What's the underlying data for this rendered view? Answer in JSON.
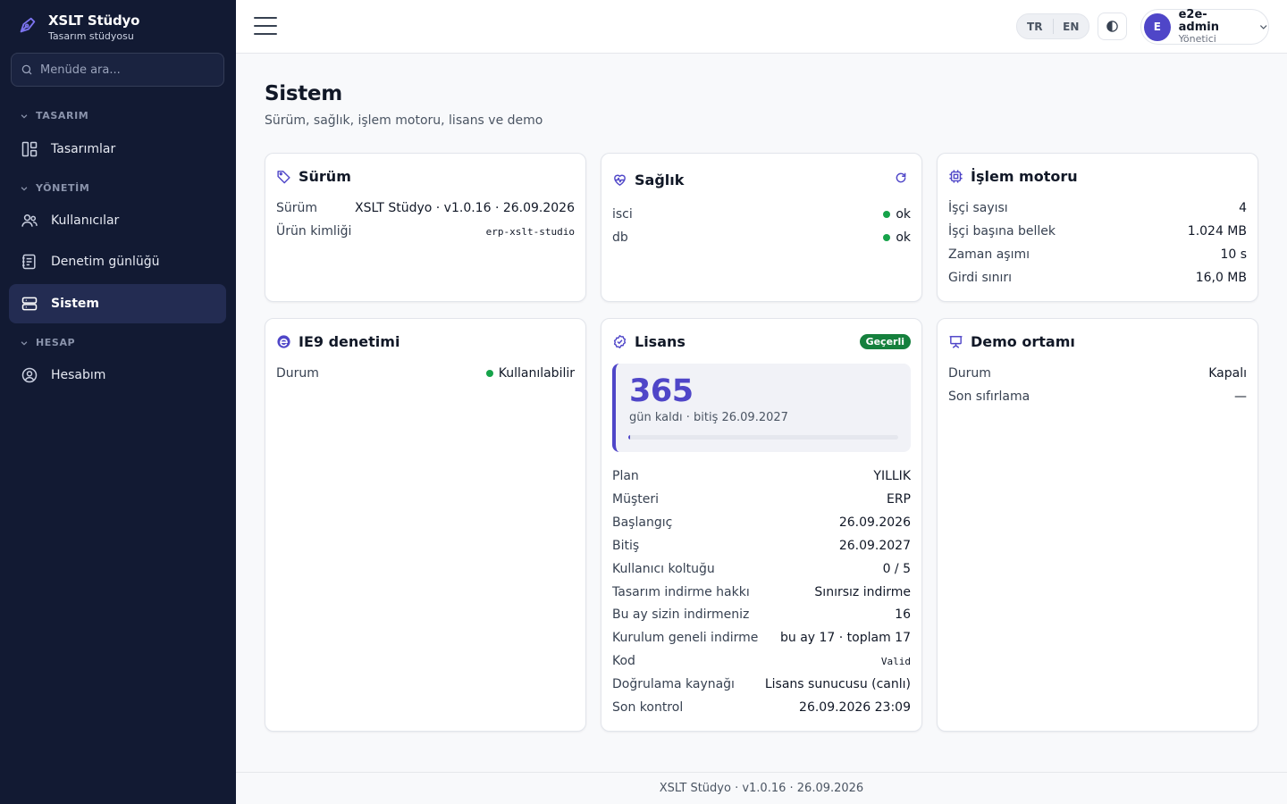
{
  "brand": {
    "title": "XSLT Stüdyo",
    "subtitle": "Tasarım stüdyosu"
  },
  "search": {
    "placeholder": "Menüde ara..."
  },
  "sidebar": {
    "sections": [
      {
        "label": "TASARIM"
      },
      {
        "label": "YÖNETİM"
      },
      {
        "label": "HESAP"
      }
    ],
    "items": [
      {
        "label": "Tasarımlar",
        "icon": "layout-icon"
      },
      {
        "label": "Kullanıcılar",
        "icon": "users-icon"
      },
      {
        "label": "Denetim günlüğü",
        "icon": "log-icon"
      },
      {
        "label": "Sistem",
        "icon": "server-icon",
        "active": true
      },
      {
        "label": "Hesabım",
        "icon": "user-circle-icon"
      }
    ]
  },
  "topbar": {
    "languages": [
      "TR",
      "EN"
    ],
    "user": {
      "initial": "E",
      "name": "e2e-admin",
      "role": "Yönetici"
    }
  },
  "page": {
    "title": "Sistem",
    "subtitle": "Sürüm, sağlık, işlem motoru, lisans ve demo"
  },
  "cards": {
    "version": {
      "title": "Sürüm",
      "rows": [
        {
          "k": "Sürüm",
          "v": "XSLT Stüdyo · v1.0.16 · 26.09.2026"
        },
        {
          "k": "Ürün kimliği",
          "v": "erp-xslt-studio"
        }
      ]
    },
    "health": {
      "title": "Sağlık",
      "rows": [
        {
          "k": "isci",
          "v": "ok"
        },
        {
          "k": "db",
          "v": "ok"
        }
      ]
    },
    "engine": {
      "title": "İşlem motoru",
      "rows": [
        {
          "k": "İşçi sayısı",
          "v": "4"
        },
        {
          "k": "İşçi başına bellek",
          "v": "1.024 MB"
        },
        {
          "k": "Zaman aşımı",
          "v": "10 s"
        },
        {
          "k": "Girdi sınırı",
          "v": "16,0 MB"
        }
      ]
    },
    "ie9": {
      "title": "IE9 denetimi",
      "rows": [
        {
          "k": "Durum",
          "v": "Kullanılabilir"
        }
      ]
    },
    "license": {
      "title": "Lisans",
      "badge": "Geçerli",
      "days": "365",
      "days_text": "gün kaldı · bitiş 26.09.2027",
      "progress": 0.003,
      "rows": [
        {
          "k": "Plan",
          "v": "YILLIK"
        },
        {
          "k": "Müşteri",
          "v": "ERP"
        },
        {
          "k": "Başlangıç",
          "v": "26.09.2026"
        },
        {
          "k": "Bitiş",
          "v": "26.09.2027"
        },
        {
          "k": "Kullanıcı koltuğu",
          "v": "0 / 5"
        },
        {
          "k": "Tasarım indirme hakkı",
          "v": "Sınırsız indirme"
        },
        {
          "k": "Bu ay sizin indirmeniz",
          "v": "16"
        },
        {
          "k": "Kurulum geneli indirme",
          "v": "bu ay 17 · toplam 17"
        },
        {
          "k": "Kod",
          "v": "Valid"
        },
        {
          "k": "Doğrulama kaynağı",
          "v": "Lisans sunucusu (canlı)"
        },
        {
          "k": "Son kontrol",
          "v": "26.09.2026 23:09"
        }
      ]
    },
    "demo": {
      "title": "Demo ortamı",
      "rows": [
        {
          "k": "Durum",
          "v": "Kapalı"
        },
        {
          "k": "Son sıfırlama",
          "v": "—"
        }
      ]
    }
  },
  "footer": {
    "text": "XSLT Stüdyo · v1.0.16 · 26.09.2026"
  },
  "colors": {
    "sidebar": "#121a33",
    "accent": "#4f46c8",
    "ok": "#16a34a",
    "badge": "#15803d"
  }
}
